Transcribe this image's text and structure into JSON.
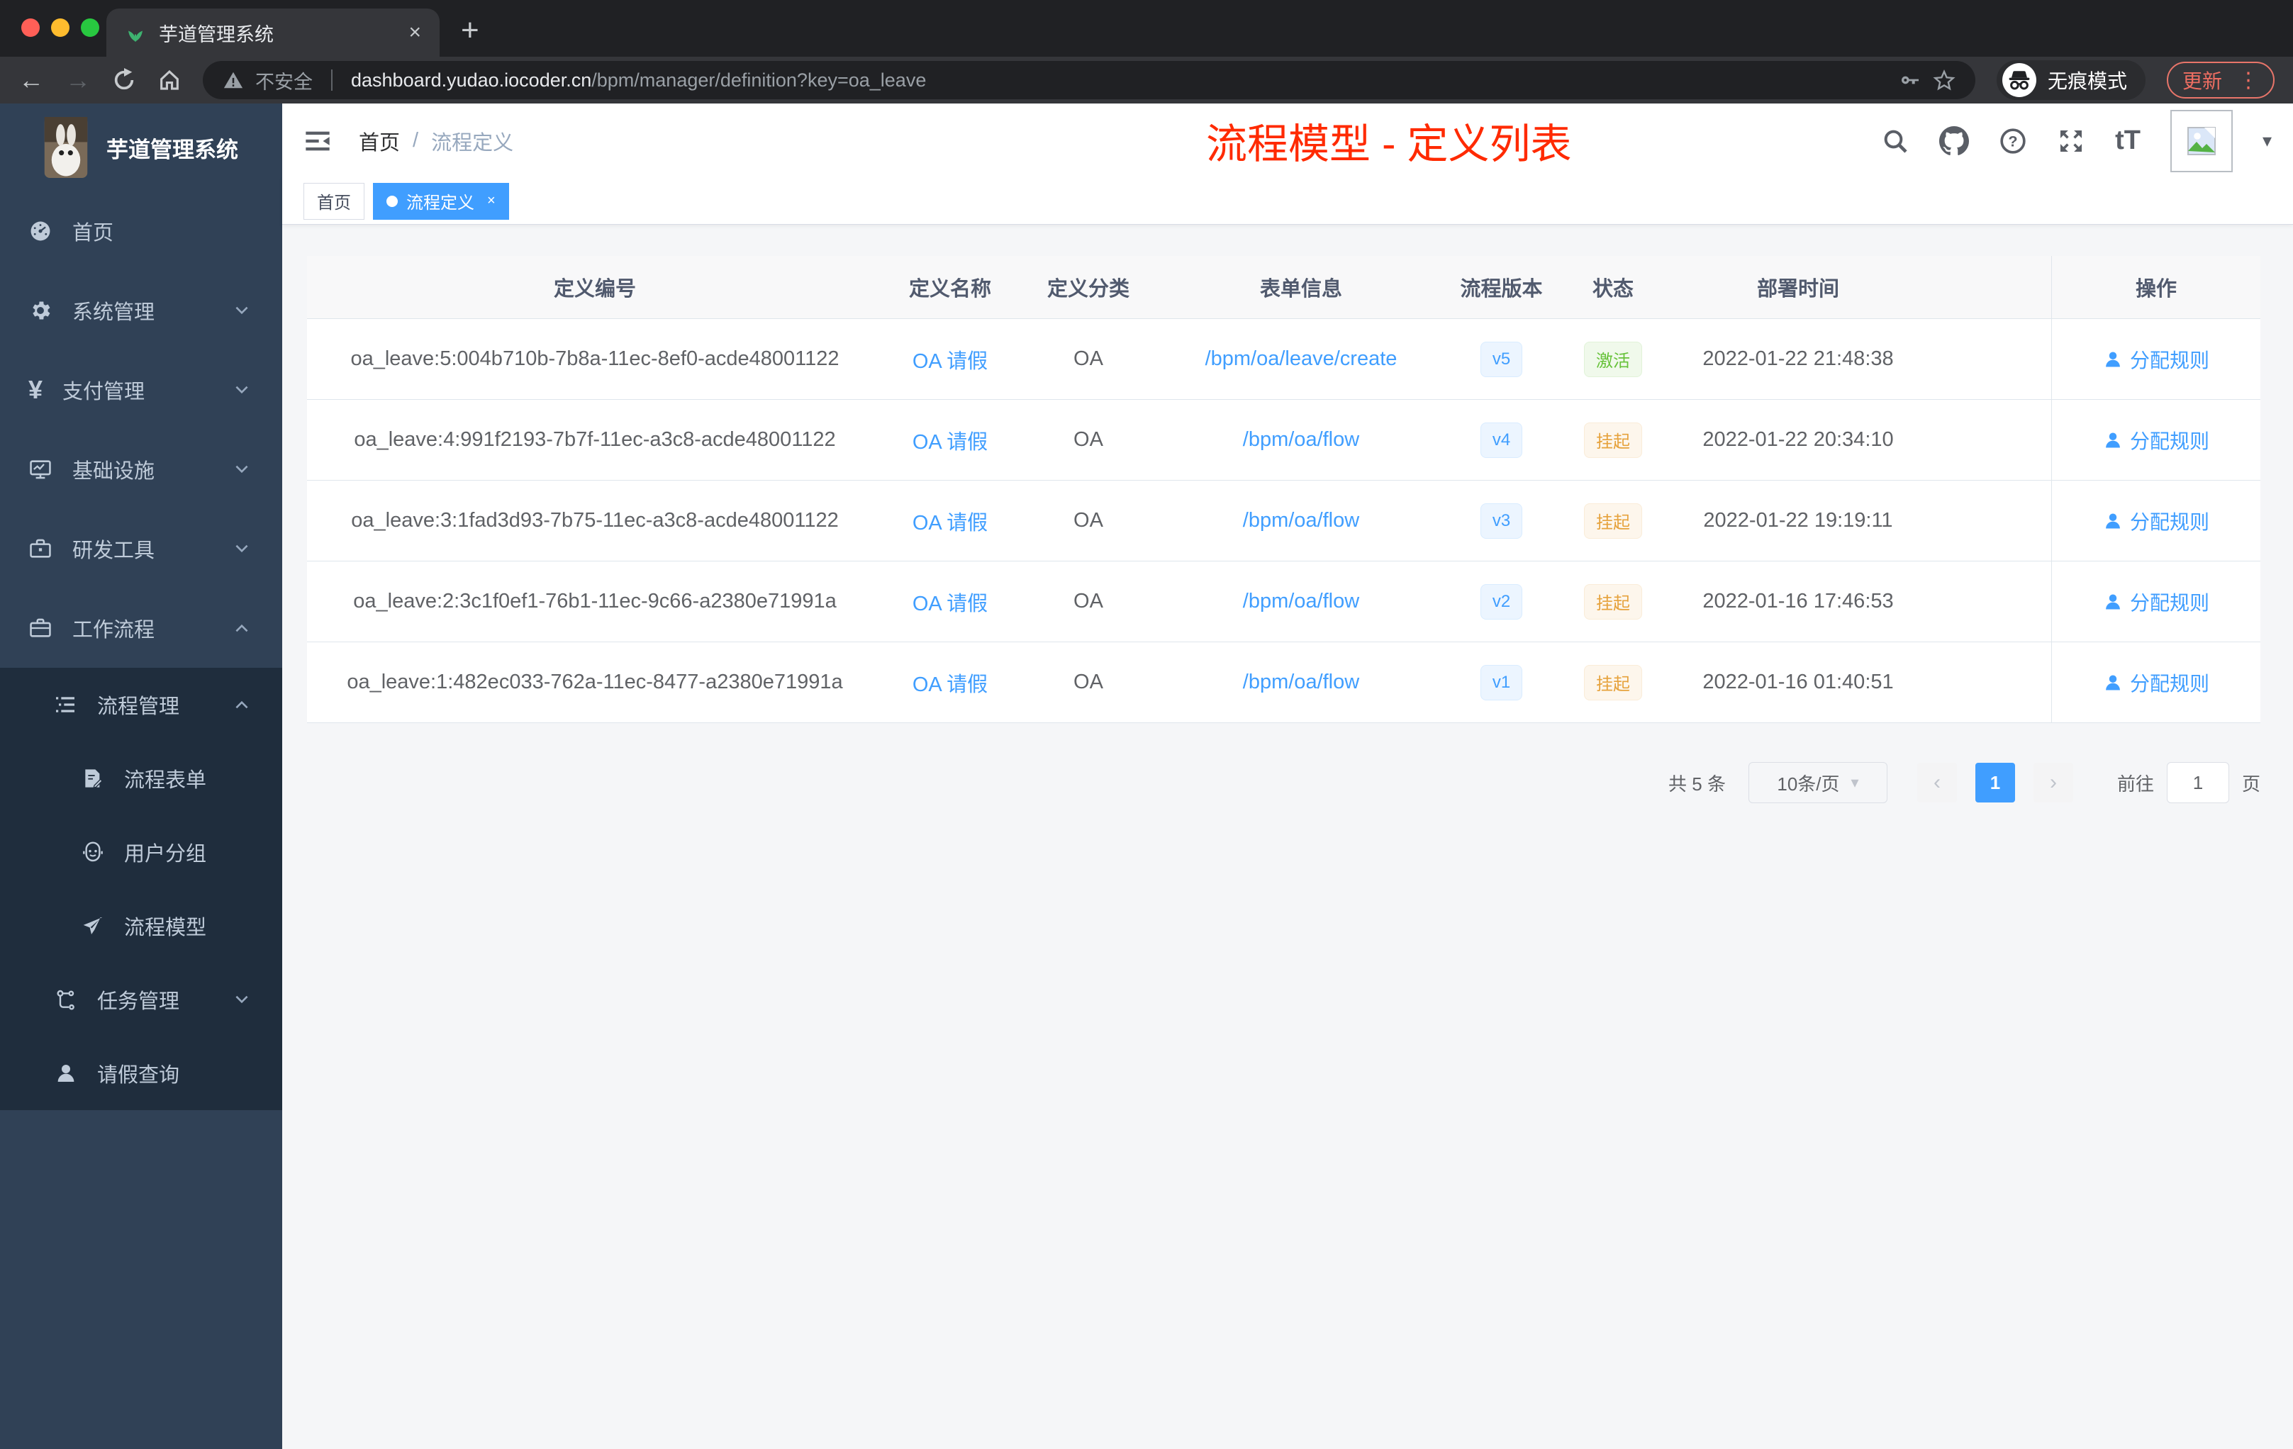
{
  "browser": {
    "tab_title": "芋道管理系统",
    "close_tab": "×",
    "new_tab": "+",
    "back": "←",
    "forward": "→",
    "security_warning": "不安全",
    "url_host": "dashboard.yudao.iocoder.cn",
    "url_path": "/bpm/manager/definition?key=oa_leave",
    "star": "☆",
    "incognito_label": "无痕模式",
    "update_button": "更新",
    "menu_dots": "⋮"
  },
  "colors": {
    "accent_blue": "#409eff",
    "sidebar_bg": "#304156",
    "submenu_bg": "#1f2d3d",
    "annotation_red": "#ff2a00",
    "success_green": "#67c23a",
    "warning_orange": "#e6a23c"
  },
  "sidebar": {
    "logo_title": "芋道管理系统",
    "items": [
      {
        "label": "首页",
        "icon": "dashboard-icon"
      },
      {
        "label": "系统管理",
        "icon": "gear-icon",
        "chevron": "down"
      },
      {
        "label": "支付管理",
        "icon": "yen-icon",
        "chevron": "down",
        "icon_glyph": "¥"
      },
      {
        "label": "基础设施",
        "icon": "monitor-icon",
        "chevron": "down"
      },
      {
        "label": "研发工具",
        "icon": "toolbox-icon",
        "chevron": "down"
      },
      {
        "label": "工作流程",
        "icon": "briefcase-icon",
        "chevron": "up"
      }
    ],
    "submenu_items": [
      {
        "label": "流程管理",
        "icon": "list-icon",
        "chevron": "up"
      },
      {
        "label": "流程表单",
        "icon": "form-icon"
      },
      {
        "label": "用户分组",
        "icon": "robot-icon"
      },
      {
        "label": "流程模型",
        "icon": "send-icon"
      },
      {
        "label": "任务管理",
        "icon": "tree-icon",
        "chevron": "down"
      },
      {
        "label": "请假查询",
        "icon": "person-icon"
      }
    ]
  },
  "navbar": {
    "breadcrumb": [
      "首页",
      "流程定义"
    ],
    "breadcrumb_separator": "/",
    "overlay_title": "流程模型 - 定义列表",
    "font_size_icon_label": "tT",
    "question_mark": "?",
    "caret": "▾"
  },
  "tagsbar": {
    "tabs": [
      {
        "label": "首页",
        "active": false
      },
      {
        "label": "流程定义",
        "active": true,
        "close": "×"
      }
    ]
  },
  "table": {
    "headers": [
      "定义编号",
      "定义名称",
      "定义分类",
      "表单信息",
      "流程版本",
      "状态",
      "部署时间",
      "操作"
    ],
    "rows": [
      {
        "id": "oa_leave:5:004b710b-7b8a-11ec-8ef0-acde48001122",
        "name": "OA 请假",
        "category": "OA",
        "form": "/bpm/oa/leave/create",
        "version": "v5",
        "status": "激活",
        "status_type": "success",
        "deploy_time": "2022-01-22 21:48:38",
        "action": "分配规则"
      },
      {
        "id": "oa_leave:4:991f2193-7b7f-11ec-a3c8-acde48001122",
        "name": "OA 请假",
        "category": "OA",
        "form": "/bpm/oa/flow",
        "version": "v4",
        "status": "挂起",
        "status_type": "warning",
        "deploy_time": "2022-01-22 20:34:10",
        "action": "分配规则"
      },
      {
        "id": "oa_leave:3:1fad3d93-7b75-11ec-a3c8-acde48001122",
        "name": "OA 请假",
        "category": "OA",
        "form": "/bpm/oa/flow",
        "version": "v3",
        "status": "挂起",
        "status_type": "warning",
        "deploy_time": "2022-01-22 19:19:11",
        "action": "分配规则"
      },
      {
        "id": "oa_leave:2:3c1f0ef1-76b1-11ec-9c66-a2380e71991a",
        "name": "OA 请假",
        "category": "OA",
        "form": "/bpm/oa/flow",
        "version": "v2",
        "status": "挂起",
        "status_type": "warning",
        "deploy_time": "2022-01-16 17:46:53",
        "action": "分配规则"
      },
      {
        "id": "oa_leave:1:482ec033-762a-11ec-8477-a2380e71991a",
        "name": "OA 请假",
        "category": "OA",
        "form": "/bpm/oa/flow",
        "version": "v1",
        "status": "挂起",
        "status_type": "warning",
        "deploy_time": "2022-01-16 01:40:51",
        "action": "分配规则"
      }
    ]
  },
  "pagination": {
    "total": "共 5 条",
    "page_size": "10条/页",
    "prev": "‹",
    "current": "1",
    "next": "›",
    "goto_label": "前往",
    "goto_value": "1",
    "goto_unit": "页",
    "select_caret": "▾"
  }
}
